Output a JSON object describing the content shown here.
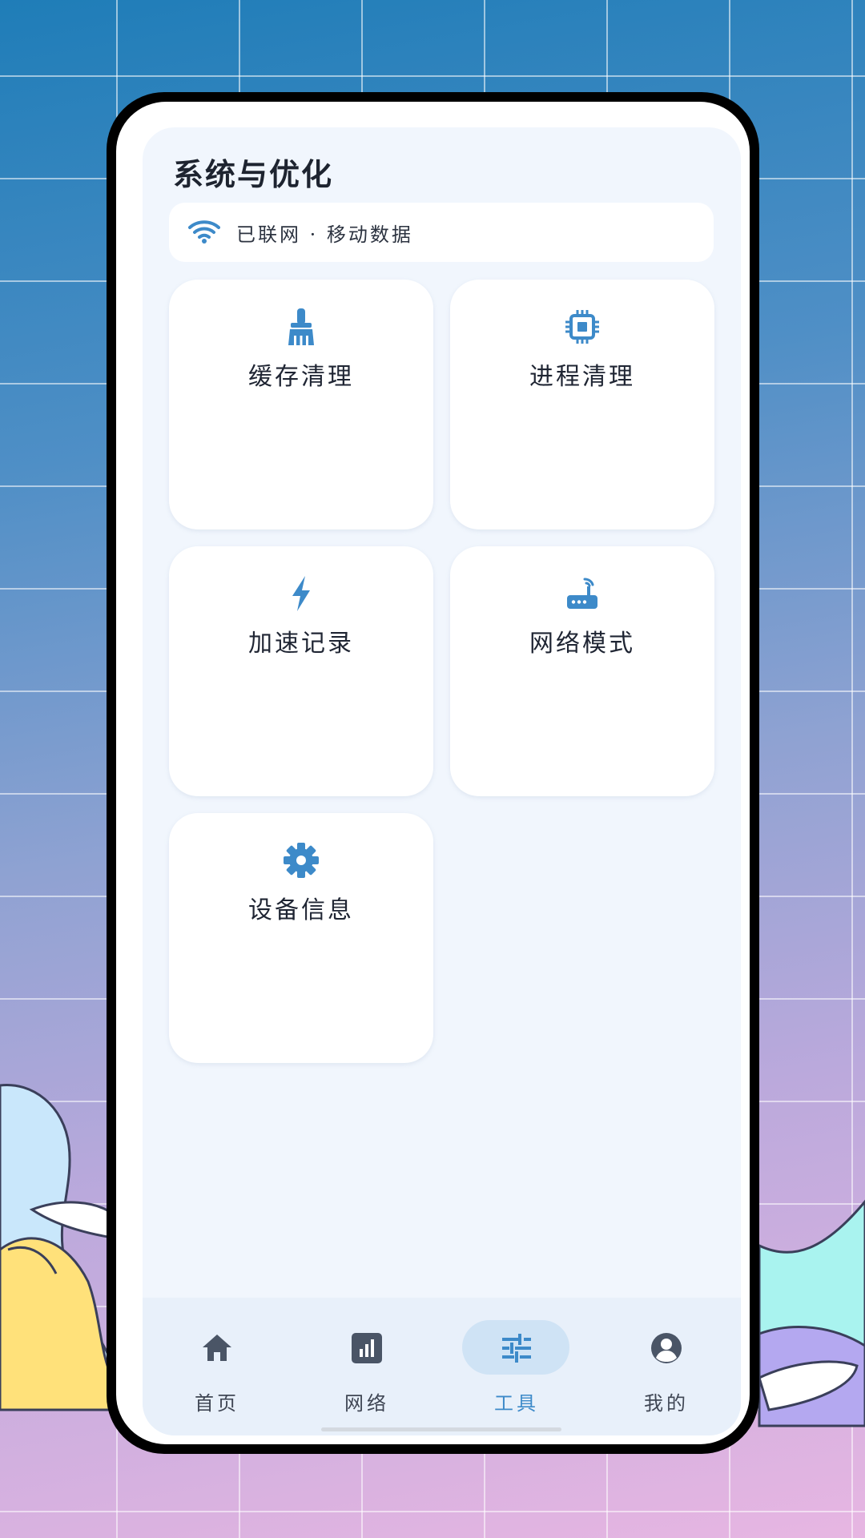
{
  "page": {
    "title": "系统与优化"
  },
  "status": {
    "text": "已联网 · 移动数据",
    "icon": "wifi-icon"
  },
  "tools": [
    {
      "label": "缓存清理",
      "icon": "broom-icon"
    },
    {
      "label": "进程清理",
      "icon": "cpu-chip-icon"
    },
    {
      "label": "加速记录",
      "icon": "lightning-bolt-icon"
    },
    {
      "label": "网络模式",
      "icon": "router-icon"
    },
    {
      "label": "设备信息",
      "icon": "gear-icon"
    }
  ],
  "nav": [
    {
      "label": "首页",
      "icon": "home-icon",
      "active": false
    },
    {
      "label": "网络",
      "icon": "signal-bars-icon",
      "active": false
    },
    {
      "label": "工具",
      "icon": "sliders-icon",
      "active": true
    },
    {
      "label": "我的",
      "icon": "account-circle-icon",
      "active": false
    }
  ],
  "colors": {
    "accent": "#3d8ac9",
    "icon_dark": "#4a5566",
    "active_pill": "#cfe3f5",
    "screen_bg": "#f1f6fd"
  }
}
